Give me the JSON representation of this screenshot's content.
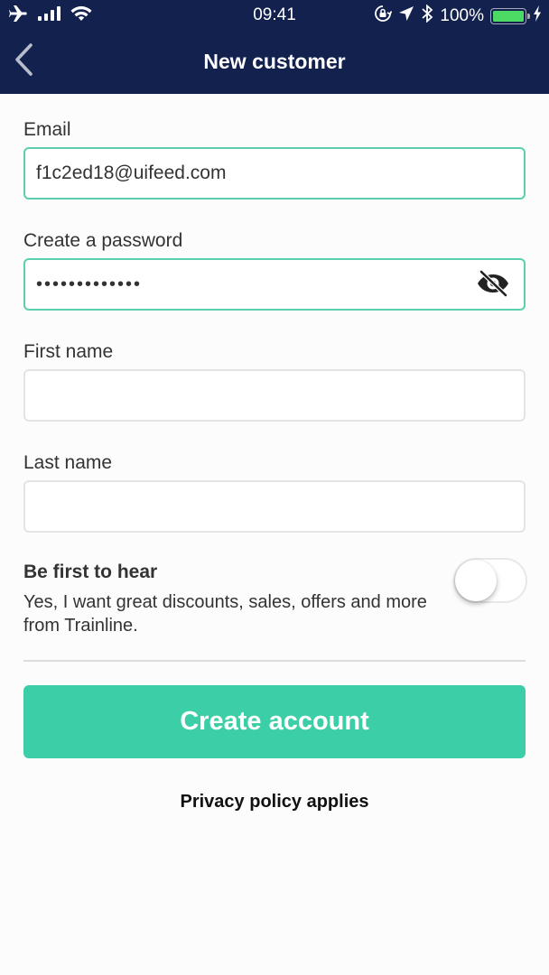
{
  "status_bar": {
    "time": "09:41",
    "battery_text": "100%",
    "battery_level_percent": 100,
    "colors": {
      "battery": "#4cd964"
    }
  },
  "nav": {
    "title": "New customer",
    "back_icon": "chevron-left-icon"
  },
  "form": {
    "email": {
      "label": "Email",
      "value": "f1c2ed18@uifeed.com",
      "focused": true
    },
    "password": {
      "label": "Create a password",
      "masked_value": "•••••••••••••",
      "char_count": 13,
      "toggle_icon": "eye-slash-icon"
    },
    "first_name": {
      "label": "First name",
      "value": ""
    },
    "last_name": {
      "label": "Last name",
      "value": ""
    }
  },
  "optin": {
    "title": "Be first to hear",
    "description": "Yes, I want great discounts, sales, offers and more from Trainline.",
    "enabled": false
  },
  "actions": {
    "create_account_label": "Create account",
    "privacy_label": "Privacy policy applies"
  },
  "colors": {
    "header_bg": "#13214f",
    "accent": "#3ccfa7",
    "focus_border": "#5ccfae"
  }
}
